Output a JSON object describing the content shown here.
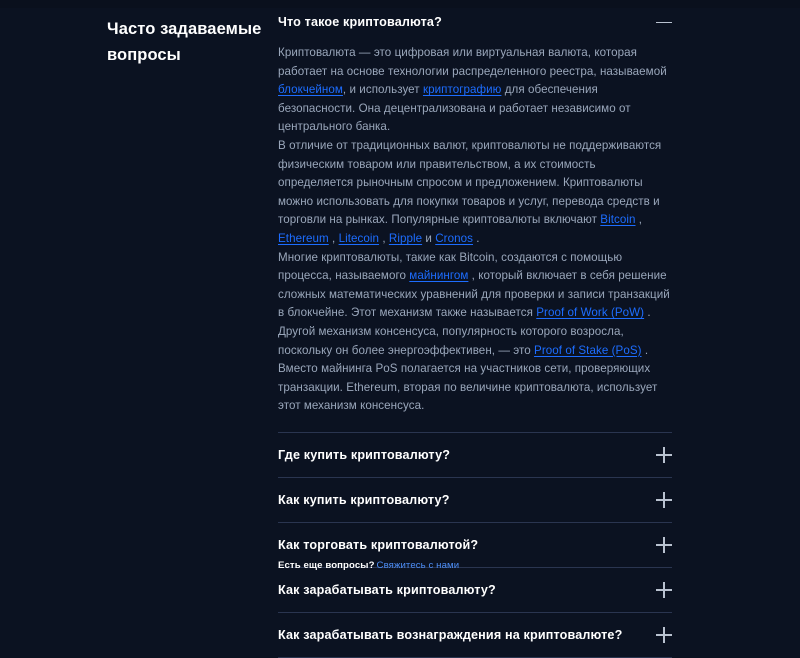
{
  "theme": {
    "background": "#0b1221",
    "top_strip": "#0a101d",
    "text_primary": "#ffffff",
    "text_body": "#9aa7bb",
    "link": "#1d6dff",
    "footer_link": "#4d8ef7",
    "divider": "#2a3550",
    "icon": "#b9c2d0"
  },
  "sidebar": {
    "heading": "Часто задаваемые вопросы"
  },
  "faq": {
    "items": [
      {
        "question": "Что такое криптовалюта?",
        "expanded": true,
        "icon": "minus-icon",
        "paragraphs": [
          {
            "segments": [
              {
                "type": "text",
                "text": "Криптовалюта — это цифровая или виртуальная валюта, которая работает на основе технологии распределенного реестра, называемой "
              },
              {
                "type": "link",
                "text": "блокчейном"
              },
              {
                "type": "text",
                "text": ", и использует "
              },
              {
                "type": "link",
                "text": "криптографию"
              },
              {
                "type": "text",
                "text": " для обеспечения безопасности. Она децентрализована и работает независимо от центрального банка."
              }
            ]
          },
          {
            "segments": [
              {
                "type": "text",
                "text": "В отличие от традиционных валют, криптовалюты не поддерживаются физическим товаром или правительством, а их стоимость определяется рыночным спросом и предложением. Криптовалюты можно использовать для покупки товаров и услуг, перевода средств и торговли на рынках. Популярные криптовалюты включают "
              },
              {
                "type": "link",
                "text": "Bitcoin"
              },
              {
                "type": "text",
                "text": " , "
              },
              {
                "type": "link",
                "text": "Ethereum"
              },
              {
                "type": "text",
                "text": " , "
              },
              {
                "type": "link",
                "text": "Litecoin"
              },
              {
                "type": "text",
                "text": " , "
              },
              {
                "type": "link",
                "text": "Ripple"
              },
              {
                "type": "text",
                "text": " и "
              },
              {
                "type": "link",
                "text": "Cronos"
              },
              {
                "type": "text",
                "text": " ."
              }
            ]
          },
          {
            "segments": [
              {
                "type": "text",
                "text": "Многие криптовалюты, такие как Bitcoin, создаются с помощью процесса, называемого "
              },
              {
                "type": "link",
                "text": "майнингом"
              },
              {
                "type": "text",
                "text": " , который включает в себя решение сложных математических уравнений для проверки и записи транзакций в блокчейне. Этот механизм также называется "
              },
              {
                "type": "link",
                "text": "Proof of Work (PoW)"
              },
              {
                "type": "text",
                "text": " . Другой механизм консенсуса, популярность которого возросла, поскольку он более энергоэффективен, — это "
              },
              {
                "type": "link",
                "text": "Proof of Stake (PoS)"
              },
              {
                "type": "text",
                "text": " . Вместо майнинга PoS полагается на участников сети, проверяющих транзакции. Ethereum, вторая по величине криптовалюта, использует этот механизм консенсуса."
              }
            ]
          }
        ]
      },
      {
        "question": "Где купить криптовалюту?",
        "expanded": false,
        "icon": "plus-icon",
        "paragraphs": []
      },
      {
        "question": "Как купить криптовалюту?",
        "expanded": false,
        "icon": "plus-icon",
        "paragraphs": []
      },
      {
        "question": "Как торговать криптовалютой?",
        "expanded": false,
        "icon": "plus-icon",
        "paragraphs": []
      },
      {
        "question": "Как зарабатывать криптовалюту?",
        "expanded": false,
        "icon": "plus-icon",
        "paragraphs": []
      },
      {
        "question": "Как зарабатывать вознаграждения на криптовалюте?",
        "expanded": false,
        "icon": "plus-icon",
        "paragraphs": []
      }
    ]
  },
  "footer": {
    "prompt": "Есть еще вопросы?",
    "contact_label": "Свяжитесь с нами"
  }
}
